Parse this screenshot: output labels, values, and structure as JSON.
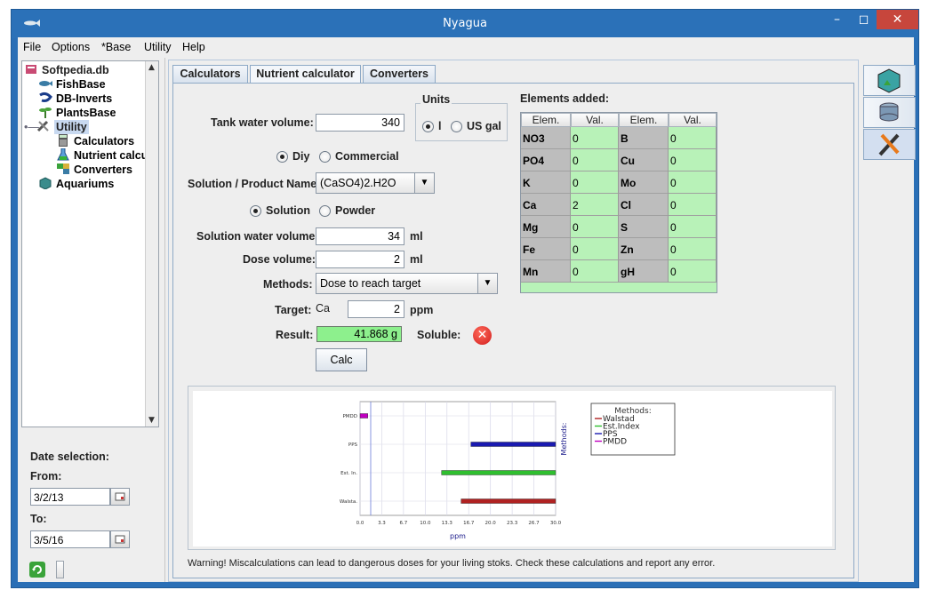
{
  "window": {
    "title": "Nyagua"
  },
  "menu": [
    "File",
    "Options",
    "*Base",
    "Utility",
    "Help"
  ],
  "tree": {
    "root": "Softpedia.db",
    "items": [
      "FishBase",
      "DB-Inverts",
      "PlantsBase",
      "Utility",
      "Aquariums"
    ],
    "utility_children": [
      "Calculators",
      "Nutrient calcul",
      "Converters"
    ]
  },
  "date_selection": {
    "title": "Date selection:",
    "from_label": "From:",
    "from_value": "3/2/13",
    "to_label": "To:",
    "to_value": "3/5/16"
  },
  "tabs": [
    "Calculators",
    "Nutrient calculator",
    "Converters"
  ],
  "form": {
    "tank_label": "Tank water volume:",
    "tank_value": "340",
    "units_title": "Units",
    "units_options": [
      "l",
      "US gal"
    ],
    "source_options": [
      "Diy",
      "Commercial"
    ],
    "product_label": "Solution / Product Name:",
    "product_value": "(CaSO4)2.H2O",
    "form_options": [
      "Solution",
      "Powder"
    ],
    "solution_label": "Solution water volume:",
    "solution_value": "34",
    "solution_unit": "ml",
    "dose_label": "Dose volume:",
    "dose_value": "2",
    "dose_unit": "ml",
    "methods_label": "Methods:",
    "methods_value": "Dose to reach target",
    "target_label": "Target:",
    "target_element": "Ca",
    "target_value": "2",
    "target_unit": "ppm",
    "result_label": "Result:",
    "result_value": "41.868 g",
    "soluble_label": "Soluble:",
    "calc_button": "Calc"
  },
  "elements": {
    "title": "Elements added:",
    "headers": [
      "Elem.",
      "Val.",
      "Elem.",
      "Val."
    ],
    "rows": [
      [
        "NO3",
        "0",
        "B",
        "0"
      ],
      [
        "PO4",
        "0",
        "Cu",
        "0"
      ],
      [
        "K",
        "0",
        "Mo",
        "0"
      ],
      [
        "Ca",
        "2",
        "Cl",
        "0"
      ],
      [
        "Mg",
        "0",
        "S",
        "0"
      ],
      [
        "Fe",
        "0",
        "Zn",
        "0"
      ],
      [
        "Mn",
        "0",
        "gH",
        "0"
      ]
    ]
  },
  "chart_data": {
    "type": "bar",
    "orientation": "horizontal-range",
    "xlabel": "ppm",
    "ylabel": "Methods:",
    "categories": [
      "PMDD",
      "PPS",
      "Est. In.",
      "Walsta."
    ],
    "ranges": [
      [
        0.0,
        1.2
      ],
      [
        17.0,
        30.0
      ],
      [
        12.5,
        30.0
      ],
      [
        15.5,
        30.0
      ]
    ],
    "colors": [
      "#c000c0",
      "#1a1ab0",
      "#2fbf2f",
      "#b02222"
    ],
    "x_ticks": [
      "0.0",
      "3.3",
      "6.7",
      "10.0",
      "13.3",
      "16.7",
      "20.0",
      "23.3",
      "26.7",
      "30.0"
    ],
    "xlim": [
      0.0,
      30.0
    ],
    "legend_title": "Methods:",
    "legend": [
      "Walstad",
      "Est.Index",
      "PPS",
      "PMDD"
    ],
    "legend_colors": [
      "#b02222",
      "#2fbf2f",
      "#1a1ab0",
      "#c000c0"
    ],
    "grid": true
  },
  "warning": "Warning! Miscalculations can lead to dangerous doses for your living stoks. Check these calculations and report any error."
}
